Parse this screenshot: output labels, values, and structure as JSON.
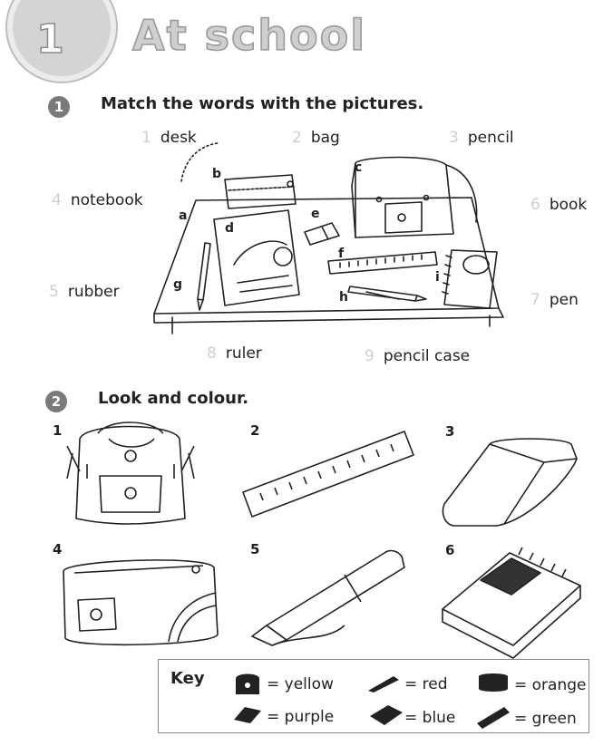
{
  "header": {
    "unit_number": "1",
    "title": "At school"
  },
  "exercise1": {
    "number": "1",
    "instruction": "Match the words with the pictures.",
    "words": [
      {
        "num": "1",
        "text": "desk"
      },
      {
        "num": "2",
        "text": "bag"
      },
      {
        "num": "3",
        "text": "pencil"
      },
      {
        "num": "4",
        "text": "notebook"
      },
      {
        "num": "5",
        "text": "rubber"
      },
      {
        "num": "6",
        "text": "book"
      },
      {
        "num": "7",
        "text": "pen"
      },
      {
        "num": "8",
        "text": "ruler"
      },
      {
        "num": "9",
        "text": "pencil case"
      }
    ],
    "picture_labels": [
      "a",
      "b",
      "c",
      "d",
      "e",
      "f",
      "g",
      "h",
      "i"
    ]
  },
  "exercise2": {
    "number": "2",
    "instruction": "Look and colour.",
    "items": [
      "1",
      "2",
      "3",
      "4",
      "5",
      "6"
    ]
  },
  "key": {
    "title": "Key",
    "entries": [
      {
        "icon": "bag-icon",
        "text": "= yellow"
      },
      {
        "icon": "pen-icon",
        "text": "= red"
      },
      {
        "icon": "pencil-case-icon",
        "text": "= orange"
      },
      {
        "icon": "rubber-icon",
        "text": "= purple"
      },
      {
        "icon": "notebook-icon",
        "text": "= blue"
      },
      {
        "icon": "ruler-icon",
        "text": "= green"
      }
    ]
  }
}
